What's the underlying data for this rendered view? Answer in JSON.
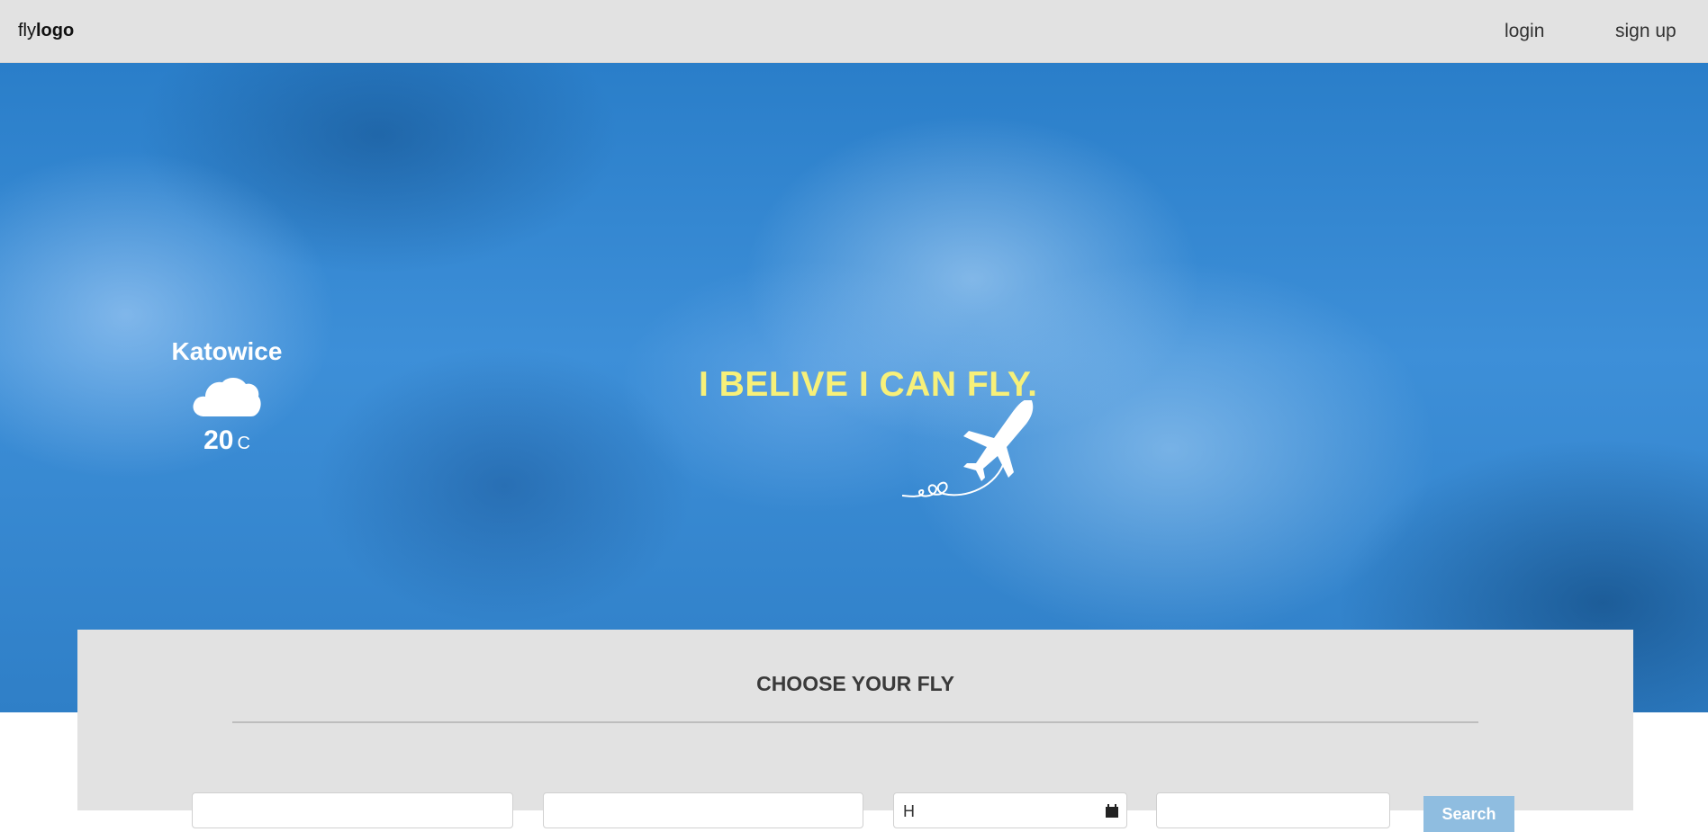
{
  "header": {
    "logo_light": "fly",
    "logo_bold": "logo",
    "nav": {
      "login": "login",
      "signup": "sign up"
    }
  },
  "hero": {
    "weather": {
      "city": "Katowice",
      "icon": "cloud-icon",
      "temperature": "20",
      "unit": "C"
    },
    "slogan": "I BELIVE I CAN FLY.",
    "slogan_color": "#f7f079",
    "plane_icon": "airplane-icon"
  },
  "search": {
    "title": "CHOOSE YOUR FLY",
    "date_value": "H",
    "search_label": "Search",
    "button_color": "#8fbde0"
  },
  "colors": {
    "topbar": "#e2e2e2",
    "panel": "#e2e2e2",
    "sky": "#2f7fc7"
  }
}
